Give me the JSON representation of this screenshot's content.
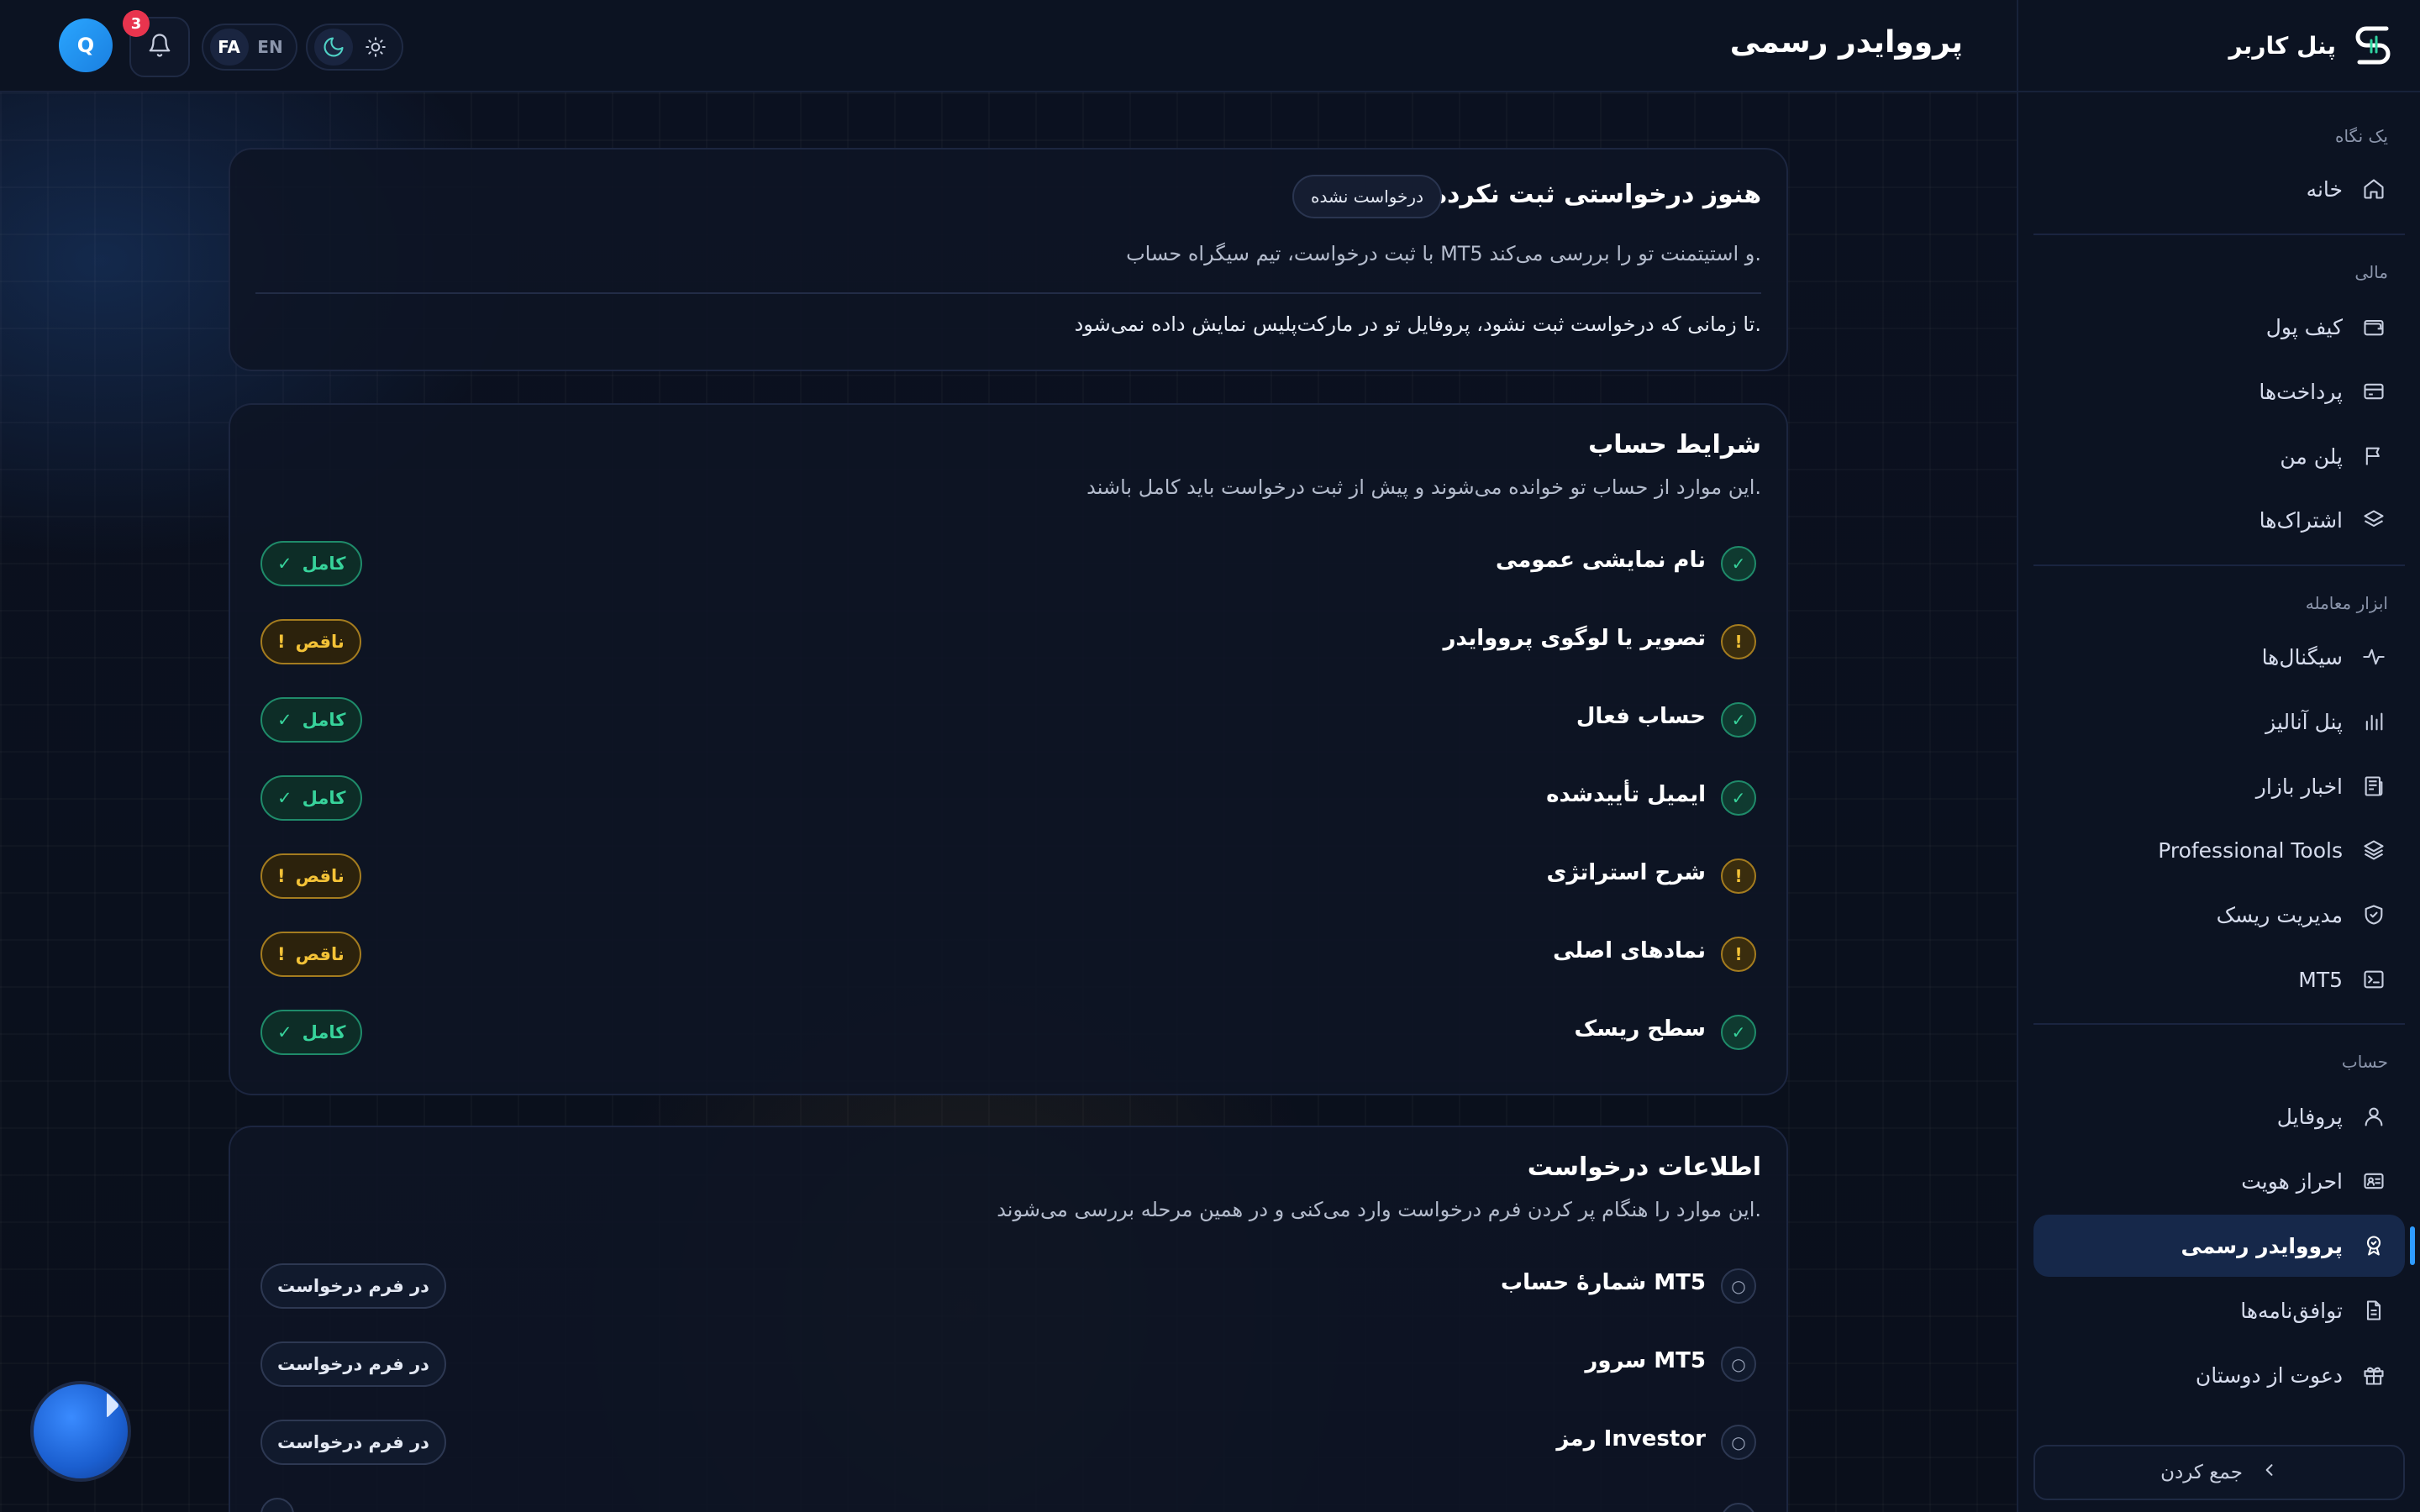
{
  "header": {
    "title": "پرووایدر رسمی",
    "avatar_letter": "Q",
    "notification_count": "3",
    "lang_options": [
      "FA",
      "EN"
    ],
    "lang_active": "FA"
  },
  "sidebar": {
    "brand": "پنل کاربر",
    "sections": {
      "overview": "یک نگاه",
      "finance": "مالی",
      "trading_tools": "ابزار معامله",
      "account": "حساب"
    },
    "items": {
      "home": "خانه",
      "wallet": "کیف پول",
      "payments": "پرداخت‌ها",
      "my_plan": "پلن من",
      "subscriptions": "اشتراک‌ها",
      "signals": "سیگنال‌ها",
      "analysis_panel": "پنل آنالیز",
      "market_news": "اخبار بازار",
      "professional_tools": "Professional Tools",
      "risk_management": "مدیریت ریسک",
      "mt5": "MT5",
      "profile": "پروفایل",
      "kyc": "احراز هویت",
      "official_provider": "پرووایدر رسمی",
      "agreements": "توافق‌نامه‌ها",
      "invite_friends": "دعوت از دوستان"
    },
    "collapse_label": "جمع کردن"
  },
  "request_card": {
    "title": "هنوز درخواستی ثبت نکرده‌ای",
    "status": "درخواست نشده",
    "subtitle": "با ثبت درخواست، تیم سیگراه حساب MT5 و استیتمنت تو را بررسی می‌کند.",
    "note": "تا زمانی که درخواست ثبت نشود، پروفایل تو در مارکت‌پلیس نمایش داده نمی‌شود."
  },
  "conditions_card": {
    "title": "شرایط حساب",
    "subtitle": "این موارد از حساب تو خوانده می‌شوند و پیش از ثبت درخواست باید کامل باشند.",
    "complete_label": "کامل",
    "incomplete_label": "ناقص",
    "rows": [
      {
        "label": "نام نمایشی عمومی",
        "status": "ok"
      },
      {
        "label": "تصویر یا لوگوی پرووایدر",
        "status": "warn"
      },
      {
        "label": "حساب فعال",
        "status": "ok"
      },
      {
        "label": "ایمیل تأییدشده",
        "status": "ok"
      },
      {
        "label": "شرح استراتژی",
        "status": "warn"
      },
      {
        "label": "نمادهای اصلی",
        "status": "warn"
      },
      {
        "label": "سطح ریسک",
        "status": "ok"
      }
    ]
  },
  "info_card": {
    "title": "اطلاعات درخواست",
    "subtitle": "این موارد را هنگام پر کردن فرم درخواست وارد می‌کنی و در همین مرحله بررسی می‌شوند.",
    "form_label": "در فرم درخواست",
    "rows": [
      {
        "label": "شمارهٔ حساب MT5"
      },
      {
        "label": "سرور MT5"
      },
      {
        "label": "رمز Investor"
      }
    ]
  },
  "colors": {
    "background": "#0a0f1c",
    "accent": "#2f9bff",
    "ok": "#37d39b",
    "warn": "#f3c237",
    "danger": "#e8344e"
  }
}
